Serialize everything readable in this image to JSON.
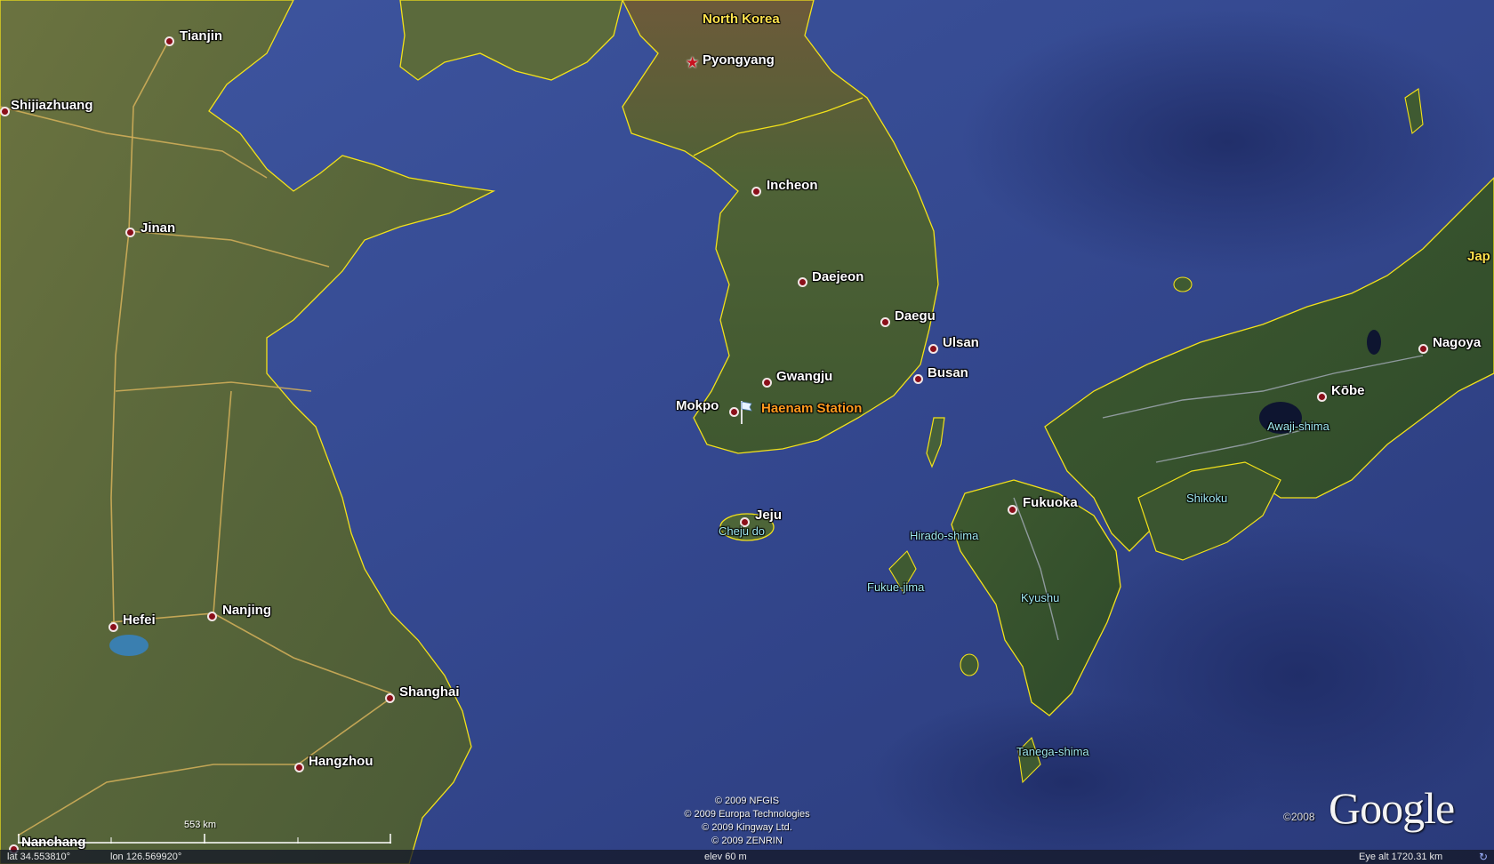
{
  "map": {
    "country_labels": [
      {
        "name": "North Korea"
      }
    ],
    "cities": [
      {
        "name": "Tianjin"
      },
      {
        "name": "Shijiazhuang"
      },
      {
        "name": "Jinan"
      },
      {
        "name": "Pyongyang"
      },
      {
        "name": "Incheon"
      },
      {
        "name": "Daejeon"
      },
      {
        "name": "Daegu"
      },
      {
        "name": "Ulsan"
      },
      {
        "name": "Busan"
      },
      {
        "name": "Gwangju"
      },
      {
        "name": "Mokpo"
      },
      {
        "name": "Jeju"
      },
      {
        "name": "Fukuoka"
      },
      {
        "name": "Kōbe"
      },
      {
        "name": "Nagoya"
      },
      {
        "name": "Hefei"
      },
      {
        "name": "Nanjing"
      },
      {
        "name": "Shanghai"
      },
      {
        "name": "Hangzhou"
      },
      {
        "name": "Nanchang"
      }
    ],
    "islands": [
      {
        "name": "Cheju do"
      },
      {
        "name": "Hirado-shima"
      },
      {
        "name": "Fukue-jima"
      },
      {
        "name": "Kyushu"
      },
      {
        "name": "Shikoku"
      },
      {
        "name": "Awaji-shima"
      },
      {
        "name": "Tanega-shima"
      },
      {
        "name": "Jap"
      }
    ],
    "placemark": {
      "name": "Haenam Station"
    },
    "copyright": [
      "© 2009 NFGIS",
      "© 2009 Europa Technologies",
      "© 2009 Kingway Ltd.",
      "© 2009 ZENRIN"
    ],
    "logo": {
      "text": "Google",
      "year": "©2008"
    },
    "scale": {
      "label": "553 km"
    }
  },
  "status": {
    "lat": "lat  34.553810°",
    "lon": "lon  126.569920°",
    "elev": "elev   60 m",
    "eye_alt": "Eye alt  1720.31 km"
  },
  "colors": {
    "sea": "#3a4f95",
    "land": "#5a6a3a",
    "border": "#f2e11a",
    "road": "#d6b25a",
    "placemark": "#ff9a1e"
  }
}
